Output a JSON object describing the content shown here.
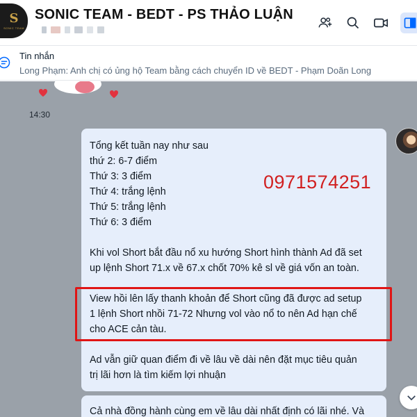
{
  "header": {
    "title": "SONIC TEAM - BEDT - PS THẢO LUẬN",
    "logo_text": "SONIC TEAM"
  },
  "pinned": {
    "title": "Tin nhắn",
    "text": "Long Phạm: Anh chị có ủng hộ Team bằng cách chuyển ID về BEDT - Phạm Doãn Long"
  },
  "chat": {
    "time": "14:30",
    "phone_overlay": "0971574251",
    "message1": {
      "lines_a": [
        "Tổng kết tuần nay như sau",
        "thứ 2:  6-7 điểm",
        "Thứ 3:  3 điểm",
        "Thứ 4:  trắng lệnh",
        "Thứ 5:  trắng lệnh",
        "Thứ 6:  3 điểm"
      ],
      "lines_b": [
        "Khi vol Short bắt đầu nổ xu hướng Short hình thành Ad đã set",
        "up lệnh Short 71.x về 67.x chốt 70% kê sl về giá vốn an toàn."
      ],
      "lines_c": [
        "View hồi lên lấy thanh khoản để Short cũng đã được ad setup",
        "1 lệnh Short nhồi 71-72 Nhưng vol vào nổ to nên Ad hạn chế",
        "cho ACE cản tàu."
      ],
      "lines_d": [
        " Ad vẫn giữ quan điểm đi về lâu về dài nên đặt mục tiêu quản",
        "trị lãi hơn là tìm kiếm lợi nhuận"
      ]
    },
    "message2": {
      "line": "Cả nhà đồng hành cùng em về lâu dài nhất định có lãi nhé. Và"
    }
  },
  "icons": [
    "add-member-icon",
    "search-icon",
    "video-call-icon",
    "sidebar-toggle-icon",
    "pin-message-icon",
    "chevron-down-icon"
  ],
  "colors": {
    "accent": "#0068ff",
    "bubble": "#e6eefb",
    "highlight": "#e01515",
    "phone": "#d11f1f"
  }
}
